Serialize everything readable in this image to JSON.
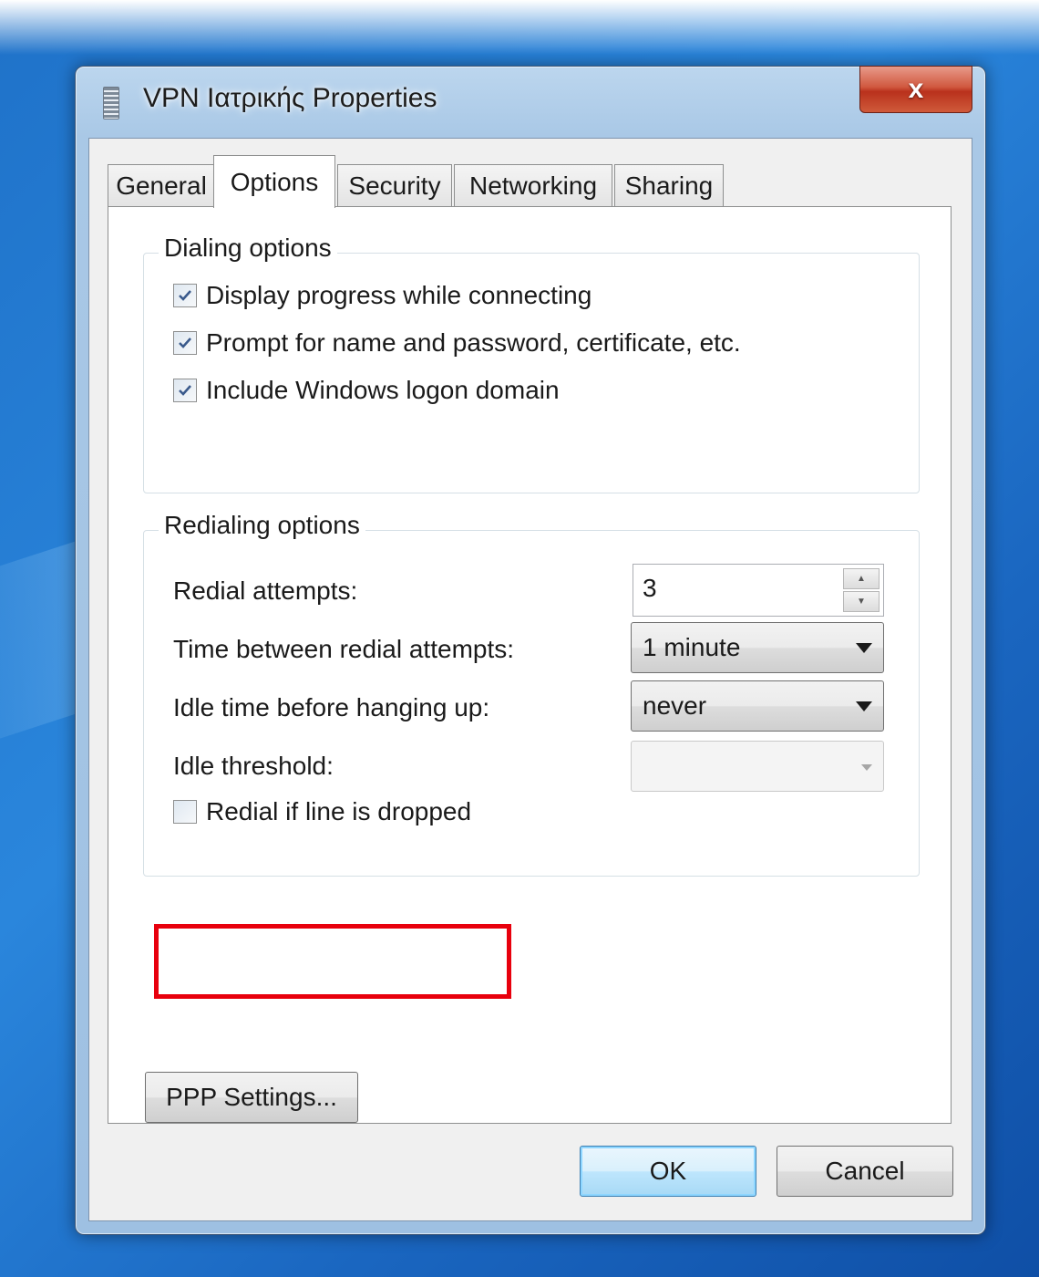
{
  "window": {
    "title": "VPN Ιατρικής Properties",
    "close_glyph": "x"
  },
  "tabs": [
    {
      "label": "General",
      "active": false
    },
    {
      "label": "Options",
      "active": true
    },
    {
      "label": "Security",
      "active": false
    },
    {
      "label": "Networking",
      "active": false
    },
    {
      "label": "Sharing",
      "active": false
    }
  ],
  "dialing": {
    "group_label": "Dialing options",
    "options": [
      {
        "label": "Display progress while connecting",
        "checked": true
      },
      {
        "label": "Prompt for name and password, certificate, etc.",
        "checked": true
      },
      {
        "label": "Include Windows logon domain",
        "checked": true
      }
    ]
  },
  "redialing": {
    "group_label": "Redialing options",
    "redial_attempts_label": "Redial attempts:",
    "redial_attempts_value": "3",
    "time_between_label": "Time between redial attempts:",
    "time_between_value": "1 minute",
    "idle_time_label": "Idle time before hanging up:",
    "idle_time_value": "never",
    "idle_threshold_label": "Idle threshold:",
    "idle_threshold_value": "",
    "redial_dropped_label": "Redial if line is dropped",
    "redial_dropped_checked": false
  },
  "buttons": {
    "ppp_settings": "PPP Settings...",
    "ok": "OK",
    "cancel": "Cancel"
  },
  "colors": {
    "highlight": "#e8000d",
    "desktop": "#1f72c9"
  }
}
